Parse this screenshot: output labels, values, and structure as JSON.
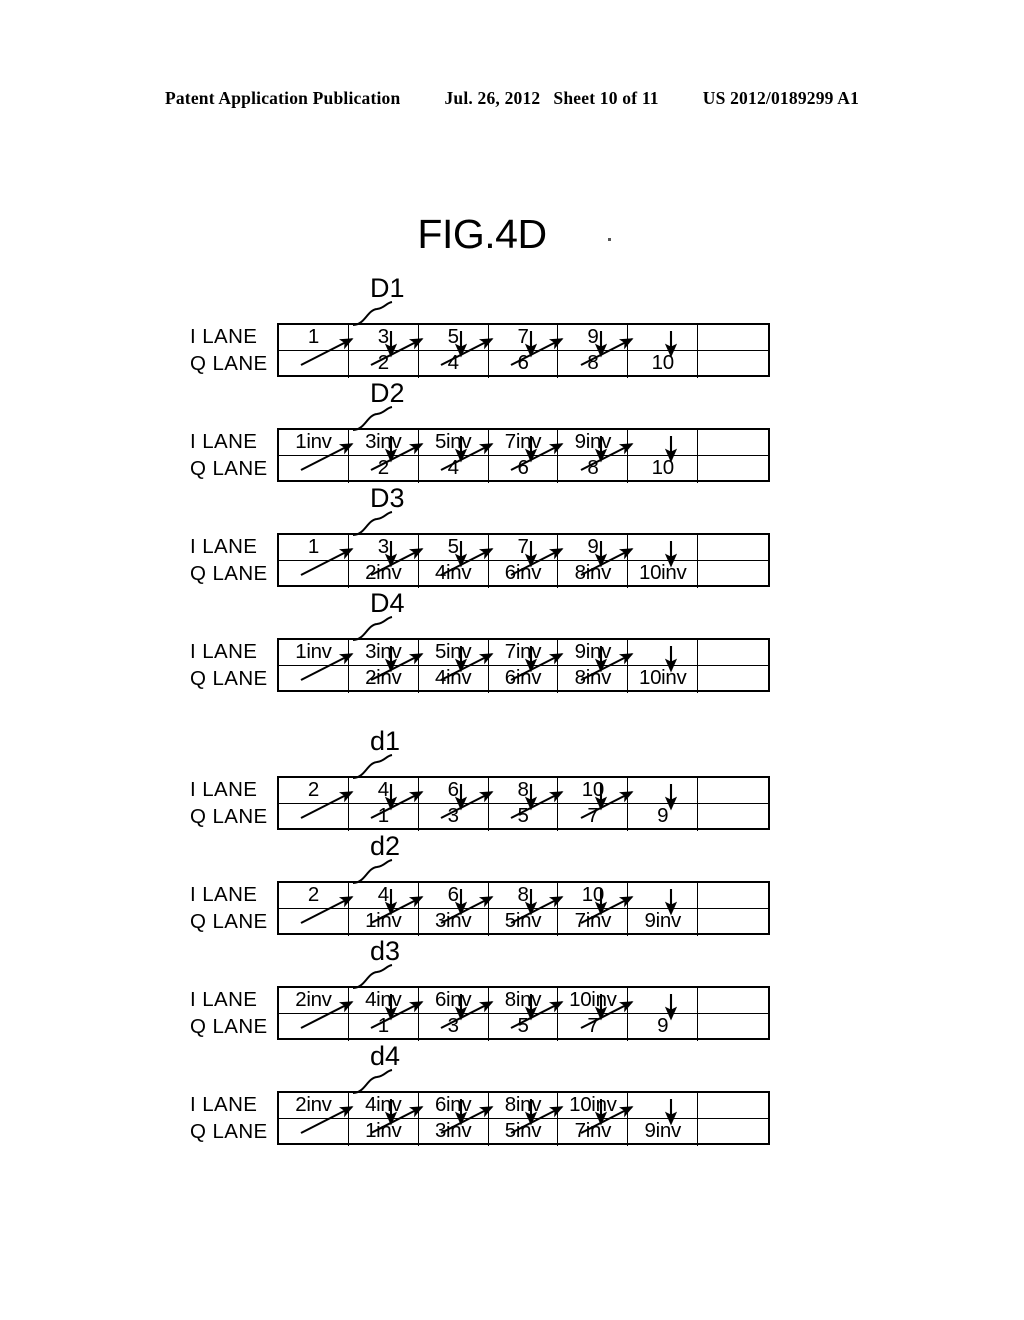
{
  "header": {
    "publication": "Patent Application Publication",
    "date": "Jul. 26, 2012",
    "sheet": "Sheet 10 of 11",
    "number": "US 2012/0189299 A1"
  },
  "figure": {
    "title": "FIG.4D"
  },
  "lane_labels": {
    "i": "I LANE",
    "q": "Q LANE"
  },
  "blocks": [
    {
      "label": "D1",
      "i_lane": [
        "1",
        "3",
        "5",
        "7",
        "9",
        "",
        ""
      ],
      "q_lane": [
        "",
        "2",
        "4",
        "6",
        "8",
        "10",
        ""
      ]
    },
    {
      "label": "D2",
      "i_lane": [
        "1inv",
        "3inv",
        "5inv",
        "7inv",
        "9inv",
        "",
        ""
      ],
      "q_lane": [
        "",
        "2",
        "4",
        "6",
        "8",
        "10",
        ""
      ]
    },
    {
      "label": "D3",
      "i_lane": [
        "1",
        "3",
        "5",
        "7",
        "9",
        "",
        ""
      ],
      "q_lane": [
        "",
        "2inv",
        "4inv",
        "6inv",
        "8inv",
        "10inv",
        ""
      ]
    },
    {
      "label": "D4",
      "i_lane": [
        "1inv",
        "3inv",
        "5inv",
        "7inv",
        "9inv",
        "",
        ""
      ],
      "q_lane": [
        "",
        "2inv",
        "4inv",
        "6inv",
        "8inv",
        "10inv",
        ""
      ]
    },
    {
      "label": "d1",
      "i_lane": [
        "2",
        "4",
        "6",
        "8",
        "10",
        "",
        ""
      ],
      "q_lane": [
        "",
        "1",
        "3",
        "5",
        "7",
        "9",
        ""
      ]
    },
    {
      "label": "d2",
      "i_lane": [
        "2",
        "4",
        "6",
        "8",
        "10",
        "",
        ""
      ],
      "q_lane": [
        "",
        "1inv",
        "3inv",
        "5inv",
        "7inv",
        "9inv",
        ""
      ]
    },
    {
      "label": "d3",
      "i_lane": [
        "2inv",
        "4inv",
        "6inv",
        "8inv",
        "10inv",
        "",
        ""
      ],
      "q_lane": [
        "",
        "1",
        "3",
        "5",
        "7",
        "9",
        ""
      ]
    },
    {
      "label": "d4",
      "i_lane": [
        "2inv",
        "4inv",
        "6inv",
        "8inv",
        "10inv",
        "",
        ""
      ],
      "q_lane": [
        "",
        "1inv",
        "3inv",
        "5inv",
        "7inv",
        "9inv",
        ""
      ]
    }
  ],
  "layout": {
    "block_tops": [
      275,
      380,
      485,
      590,
      728,
      833,
      938,
      1043
    ]
  },
  "colors": {
    "ink": "#000000",
    "paper": "#ffffff"
  }
}
